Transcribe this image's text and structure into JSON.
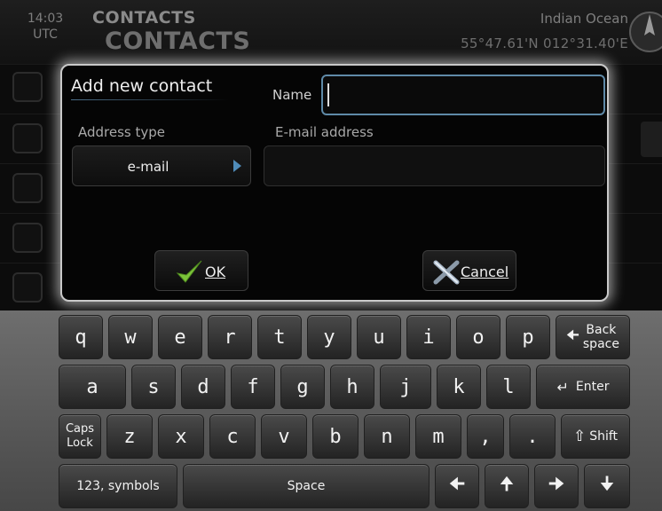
{
  "header": {
    "time": "14:03",
    "timezone": "UTC",
    "title_small": "CONTACTS",
    "title_large": "CONTACTS",
    "location": "Indian Ocean",
    "coordinates": "55°47.61'N 012°31.40'E"
  },
  "dialog": {
    "title": "Add new contact",
    "name_label": "Name",
    "name_value": "",
    "address_type_label": "Address type",
    "address_type_value": "e-mail",
    "email_label": "E-mail address",
    "email_value": "",
    "ok_label": "OK",
    "cancel_label": "Cancel"
  },
  "keyboard": {
    "row1": [
      "q",
      "w",
      "e",
      "r",
      "t",
      "y",
      "u",
      "i",
      "o",
      "p"
    ],
    "row2": [
      "a",
      "s",
      "d",
      "f",
      "g",
      "h",
      "j",
      "k",
      "l"
    ],
    "row3": [
      "z",
      "x",
      "c",
      "v",
      "b",
      "n",
      "m",
      ",",
      "."
    ],
    "backspace_line1": "Back",
    "backspace_line2": "space",
    "enter_label": "Enter",
    "caps_line1": "Caps",
    "caps_line2": "Lock",
    "shift_label": "Shift",
    "symbols_label": "123, symbols",
    "space_label": "Space"
  },
  "colors": {
    "accent_blue": "#5f8aa8",
    "ok_check_green": "#7cc43a",
    "dialog_border": "#c9c9c9"
  }
}
